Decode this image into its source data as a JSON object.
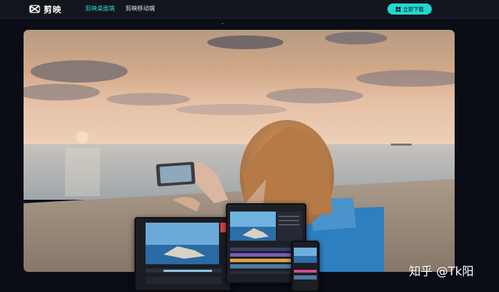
{
  "navbar": {
    "logo_text": "剪映",
    "nav_desktop": "剪映桌面端",
    "nav_mobile": "剪映移动端",
    "download_label": "立即下载"
  },
  "hero": {
    "icons": [
      "windows-icon",
      "capcut-logo-icon"
    ]
  },
  "watermark": {
    "text": "知乎 @Tk阳"
  },
  "colors": {
    "accent": "#20d8d0",
    "nav_bg": "#13151c",
    "page_bg": "#0a0d16"
  }
}
